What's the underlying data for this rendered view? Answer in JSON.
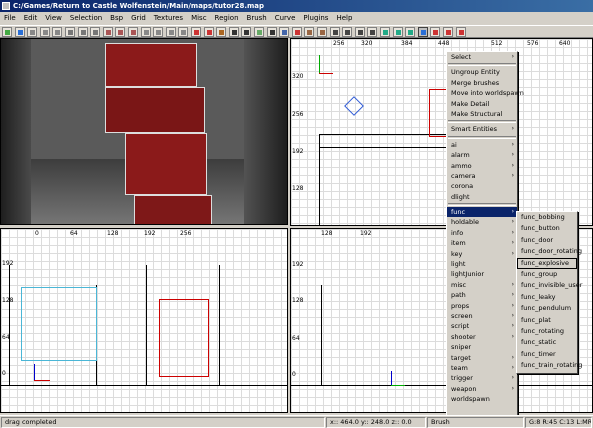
{
  "window": {
    "title": "C:/Games/Return to Castle Wolfenstein/Main/maps/tutor28.map"
  },
  "menubar": [
    "File",
    "Edit",
    "View",
    "Selection",
    "Bsp",
    "Grid",
    "Textures",
    "Misc",
    "Region",
    "Brush",
    "Curve",
    "Plugins",
    "Help"
  ],
  "rulers": {
    "top_x": [
      "256",
      "320",
      "384",
      "448",
      "512",
      "576",
      "640"
    ],
    "top_y": [
      "320",
      "256",
      "192",
      "128"
    ],
    "left_x": [
      "0",
      "64",
      "128",
      "192",
      "256"
    ],
    "left_y": [
      "192",
      "128",
      "64",
      "0"
    ],
    "right_x": [
      "128",
      "192"
    ],
    "right_y": [
      "192",
      "128",
      "64",
      "0"
    ]
  },
  "context_menu": {
    "items": [
      {
        "label": "Select",
        "arrow": "›",
        "type": "item"
      },
      {
        "type": "sep"
      },
      {
        "label": "Ungroup Entity",
        "type": "item"
      },
      {
        "label": "Merge brushes",
        "type": "item"
      },
      {
        "label": "Move into worldspawn",
        "type": "item"
      },
      {
        "label": "Make Detail",
        "type": "item"
      },
      {
        "label": "Make Structural",
        "type": "item"
      },
      {
        "type": "sep"
      },
      {
        "label": "Smart Entities",
        "arrow": "›",
        "type": "item"
      },
      {
        "type": "sep"
      },
      {
        "label": "ai",
        "arrow": "›",
        "type": "item"
      },
      {
        "label": "alarm",
        "arrow": "›",
        "type": "item"
      },
      {
        "label": "ammo",
        "arrow": "›",
        "type": "item"
      },
      {
        "label": "camera",
        "arrow": "›",
        "type": "item"
      },
      {
        "label": "corona",
        "type": "item"
      },
      {
        "label": "dlight",
        "type": "item"
      },
      {
        "type": "sep"
      },
      {
        "label": "func",
        "arrow": "›",
        "type": "item",
        "highlight": true
      },
      {
        "label": "holdable",
        "arrow": "›",
        "type": "item"
      },
      {
        "label": "info",
        "arrow": "›",
        "type": "item"
      },
      {
        "label": "item",
        "arrow": "›",
        "type": "item"
      },
      {
        "label": "key",
        "arrow": "›",
        "type": "item"
      },
      {
        "label": "light",
        "type": "item"
      },
      {
        "label": "lightJunior",
        "type": "item"
      },
      {
        "label": "misc",
        "arrow": "›",
        "type": "item"
      },
      {
        "label": "path",
        "arrow": "›",
        "type": "item"
      },
      {
        "label": "props",
        "arrow": "›",
        "type": "item"
      },
      {
        "label": "screen",
        "arrow": "›",
        "type": "item"
      },
      {
        "label": "script",
        "arrow": "›",
        "type": "item"
      },
      {
        "label": "shooter",
        "arrow": "›",
        "type": "item"
      },
      {
        "label": "sniper",
        "type": "item"
      },
      {
        "label": "target",
        "arrow": "›",
        "type": "item"
      },
      {
        "label": "team",
        "arrow": "›",
        "type": "item"
      },
      {
        "label": "trigger",
        "arrow": "›",
        "type": "item"
      },
      {
        "label": "weapon",
        "arrow": "›",
        "type": "item"
      },
      {
        "label": "worldspawn",
        "type": "item"
      }
    ]
  },
  "func_submenu": {
    "items": [
      {
        "label": "func_bobbing"
      },
      {
        "label": "func_button"
      },
      {
        "label": "func_door"
      },
      {
        "label": "func_door_rotating"
      },
      {
        "label": "func_explosive",
        "boxed": true
      },
      {
        "label": "func_group"
      },
      {
        "label": "func_invisible_user"
      },
      {
        "label": "func_leaky"
      },
      {
        "label": "func_pendulum"
      },
      {
        "label": "func_plat"
      },
      {
        "label": "func_rotating"
      },
      {
        "label": "func_static"
      },
      {
        "label": "func_timer"
      },
      {
        "label": "func_train_rotating"
      }
    ]
  },
  "status": {
    "message": "drag completed",
    "coords": "x:: 464.0  y:: 248.0  z:: 0.0",
    "brush": "Brush",
    "grid": "G:8 R:45 C:13 L:MR"
  },
  "colors": {
    "accent": "#0a246a",
    "brush_red": "#8b1a1a",
    "selection_blue": "#2f5bd6"
  }
}
